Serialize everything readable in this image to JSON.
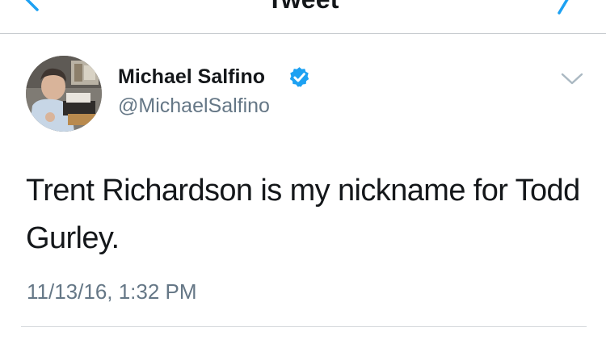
{
  "navbar": {
    "title": "Tweet",
    "back_icon": "chevron-left-icon",
    "compose_icon": "compose-icon",
    "accent_color": "#1da1f2"
  },
  "tweet": {
    "author": {
      "display_name": "Michael Salfino",
      "handle": "@MichaelSalfino",
      "verified": true
    },
    "text": "Trent Richardson is my nickname for Todd Gurley.",
    "timestamp": "11/13/16, 1:32 PM",
    "menu_icon": "chevron-down-icon"
  },
  "colors": {
    "primary_text": "#14171a",
    "secondary_text": "#657786",
    "verified_blue": "#1da1f2",
    "divider": "#c8ccd0"
  }
}
